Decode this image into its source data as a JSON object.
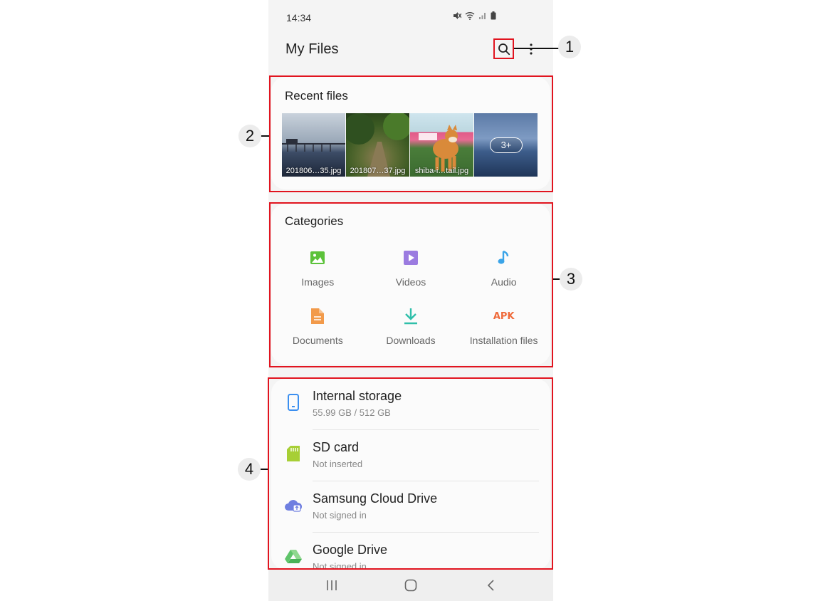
{
  "status_bar": {
    "time": "14:34"
  },
  "app_bar": {
    "title": "My Files",
    "search_icon": "search-icon",
    "more_icon": "more-vert-icon"
  },
  "recent": {
    "title": "Recent files",
    "items": [
      {
        "name": "201806…35.jpg"
      },
      {
        "name": "201807…37.jpg"
      },
      {
        "name": "shiba-i…tail.jpg"
      },
      {
        "badge": "3+"
      }
    ]
  },
  "categories": {
    "title": "Categories",
    "items": [
      {
        "label": "Images",
        "icon": "image-icon",
        "color": "#5cc23a"
      },
      {
        "label": "Videos",
        "icon": "video-icon",
        "color": "#9b7be0"
      },
      {
        "label": "Audio",
        "icon": "music-note-icon",
        "color": "#3ba4e8"
      },
      {
        "label": "Documents",
        "icon": "document-icon",
        "color": "#f29a4a"
      },
      {
        "label": "Downloads",
        "icon": "download-icon",
        "color": "#2fbfaa"
      },
      {
        "label": "Installation files",
        "icon": "apk-icon",
        "icon_text": "APK",
        "color": "#ef6a3a"
      }
    ]
  },
  "storage": {
    "items": [
      {
        "title": "Internal storage",
        "subtitle": "55.99 GB / 512 GB",
        "icon": "phone-storage-icon",
        "color": "#3b8ff0"
      },
      {
        "title": "SD card",
        "subtitle": "Not inserted",
        "icon": "sd-card-icon",
        "color": "#a7cf35"
      },
      {
        "title": "Samsung Cloud Drive",
        "subtitle": "Not signed in",
        "icon": "cloud-icon",
        "color": "#6f7fe0"
      },
      {
        "title": "Google Drive",
        "subtitle": "Not signed in",
        "icon": "google-drive-icon",
        "color": "#5fc46a"
      }
    ]
  },
  "nav_bar": {
    "recents_icon": "recents-icon",
    "home_icon": "home-icon",
    "back_icon": "back-icon"
  },
  "annotations": {
    "accent": "#e1141f",
    "labels": [
      "1",
      "2",
      "3",
      "4"
    ]
  }
}
